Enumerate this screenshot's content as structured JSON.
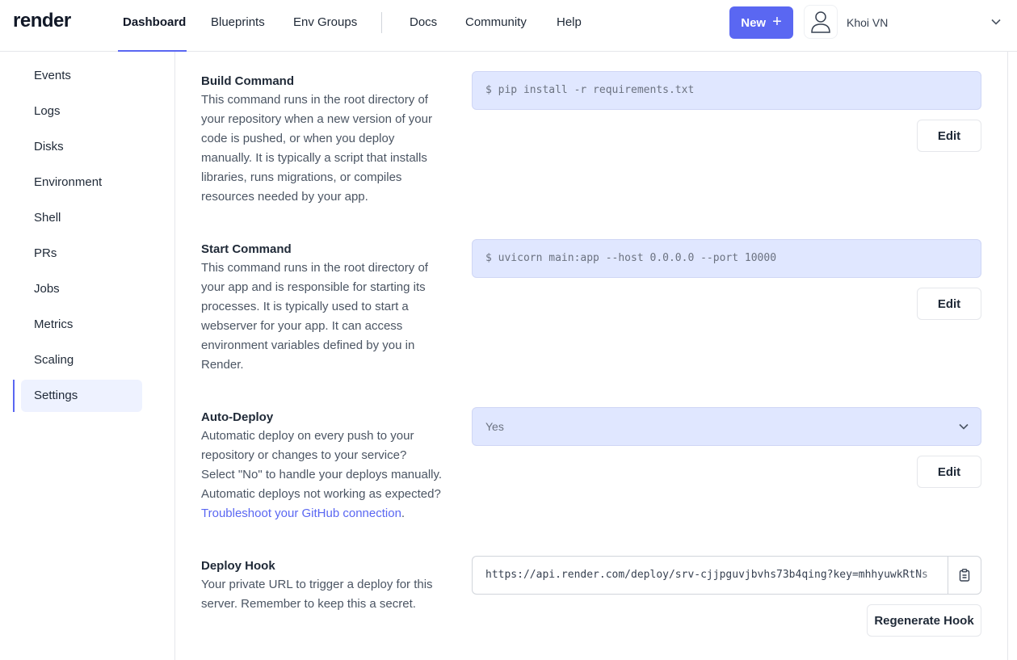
{
  "header": {
    "logo": "render",
    "nav": [
      "Dashboard",
      "Blueprints",
      "Env Groups",
      "Docs",
      "Community",
      "Help"
    ],
    "active_nav": "Dashboard",
    "new_button": "New",
    "user_name": "Khoi VN"
  },
  "sidebar": {
    "items": [
      "Events",
      "Logs",
      "Disks",
      "Environment",
      "Shell",
      "PRs",
      "Jobs",
      "Metrics",
      "Scaling",
      "Settings"
    ],
    "active": "Settings"
  },
  "sections": {
    "build": {
      "title": "Build Command",
      "description": "This command runs in the root directory of your repository when a new version of your code is pushed, or when you deploy manually. It is typically a script that installs libraries, runs migrations, or compiles resources needed by your app.",
      "value": "$ pip install -r requirements.txt",
      "edit_label": "Edit"
    },
    "start": {
      "title": "Start Command",
      "description": "This command runs in the root directory of your app and is responsible for starting its processes. It is typically used to start a webserver for your app. It can access environment variables defined by you in Render.",
      "value": "$ uvicorn main:app --host 0.0.0.0 --port 10000",
      "edit_label": "Edit"
    },
    "autodeploy": {
      "title": "Auto-Deploy",
      "description": "Automatic deploy on every push to your repository or changes to your service? Select \"No\" to handle your deploys manually. Automatic deploys not working as expected?",
      "link": "Troubleshoot your GitHub connection",
      "link_suffix": ".",
      "value": "Yes",
      "edit_label": "Edit"
    },
    "hook": {
      "title": "Deploy Hook",
      "description": "Your private URL to trigger a deploy for this server. Remember to keep this a secret.",
      "value": "https://api.render.com/deploy/srv-cjjpguvjbvhs73b4qing?key=mhhyuwkRtNs",
      "regenerate_label": "Regenerate Hook"
    }
  },
  "colors": {
    "accent": "#5a67f2",
    "field_bg": "#e0e7ff",
    "sidebar_active_bg": "#eef2ff"
  }
}
